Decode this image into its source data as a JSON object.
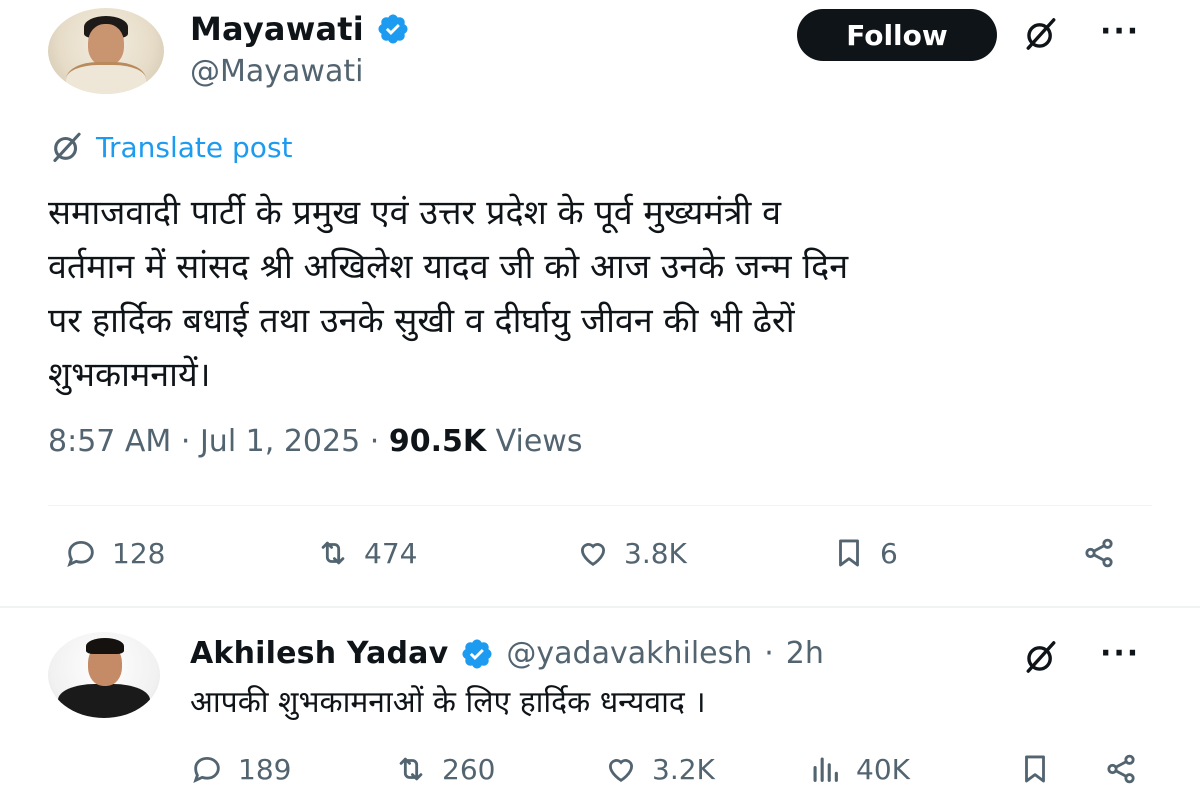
{
  "post": {
    "author": {
      "name": "Mayawati",
      "handle": "@Mayawati"
    },
    "follow_label": "Follow",
    "more_label": "···",
    "translate_label": "Translate post",
    "text": "समाजवादी पार्टी के प्रमुख एवं उत्तर प्रदेश के पूर्व मुख्यमंत्री व\nवर्तमान में सांसद श्री अखिलेश यादव जी को आज उनके जन्म दिन\nपर हार्दिक बधाई तथा उनके सुखी व दीर्घायु जीवन की भी ढेरों\nशुभकामनायें।",
    "time": "8:57 AM",
    "date": "Jul 1, 2025",
    "views_count": "90.5K",
    "views_label": "Views",
    "separator": "·",
    "actions": {
      "replies": "128",
      "reposts": "474",
      "likes": "3.8K",
      "bookmarks": "6"
    }
  },
  "reply": {
    "author": {
      "name": "Akhilesh Yadav",
      "handle": "@yadavakhilesh",
      "age": "2h"
    },
    "separator": "·",
    "more_label": "···",
    "text": "आपकी शुभकामनाओं के लिए हार्दिक धन्यवाद ।",
    "actions": {
      "replies": "189",
      "reposts": "260",
      "likes": "3.2K",
      "views": "40K"
    }
  },
  "colors": {
    "text": "#0f1419",
    "secondary": "#536471",
    "link": "#1d9bf0",
    "verified": "#1d9bf0",
    "divider": "#eff3f4"
  }
}
